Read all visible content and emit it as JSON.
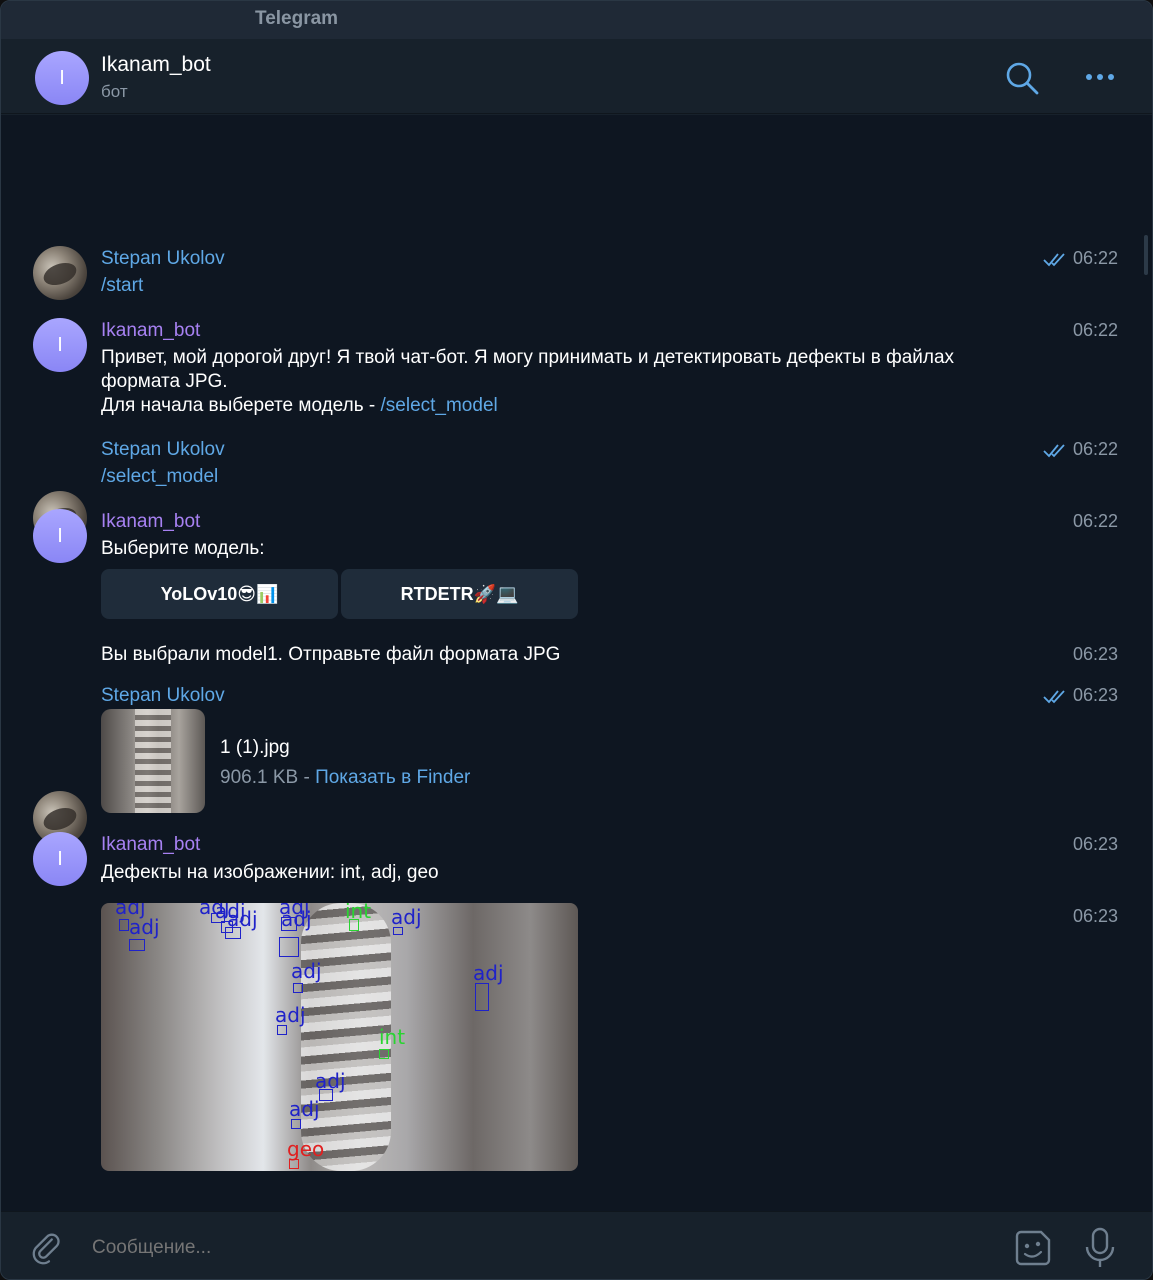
{
  "app": {
    "title": "Telegram"
  },
  "header": {
    "avatar_letter": "I",
    "chat_name": "Ikanam_bot",
    "status": "бот"
  },
  "messages": [
    {
      "sender": "Stepan Ukolov",
      "text": "/start",
      "time": "06:22",
      "read": true
    },
    {
      "sender": "Ikanam_bot",
      "avatar_letter": "I",
      "line1": "Привет, мой дорогой друг! Я твой чат-бот. Я могу принимать и детектировать дефекты в файлах",
      "line2": "формата JPG.",
      "line3_prefix": "Для начала выберете модель - ",
      "line3_link": "/select_model",
      "time": "06:22"
    },
    {
      "sender": "Stepan Ukolov",
      "text": "/select_model",
      "time": "06:22",
      "read": true
    },
    {
      "sender": "Ikanam_bot",
      "avatar_letter": "I",
      "text": "Выберите модель:",
      "time": "06:22",
      "buttons": [
        "YoLOv10😎📊",
        "RTDETR🚀💻"
      ]
    },
    {
      "text": "Вы выбрали model1. Отправьте файл формата JPG",
      "time": "06:23"
    },
    {
      "sender": "Stepan Ukolov",
      "file_name": "1 (1).jpg",
      "file_size": "906.1 KB",
      "separator": " - ",
      "file_action": "Показать в Finder",
      "time": "06:23",
      "read": true
    },
    {
      "sender": "Ikanam_bot",
      "avatar_letter": "I",
      "text": "Дефекты на изображении: int, adj, geo",
      "time": "06:23",
      "photo_time": "06:23"
    }
  ],
  "detections": {
    "labels": [
      "adj",
      "adj",
      "adj",
      "adj",
      "adj",
      "int",
      "adj",
      "adj",
      "adj",
      "adj",
      "adj",
      "adj",
      "int",
      "adj",
      "adj",
      "geo"
    ],
    "class_colors": {
      "adj": "#1f22c9",
      "int": "#29d431",
      "geo": "#e02020"
    }
  },
  "composer": {
    "placeholder": "Сообщение..."
  },
  "icons": {
    "attach": "paperclip-icon",
    "sticker": "sticker-icon",
    "mic": "microphone-icon",
    "search": "search-icon",
    "more": "more-icon"
  }
}
